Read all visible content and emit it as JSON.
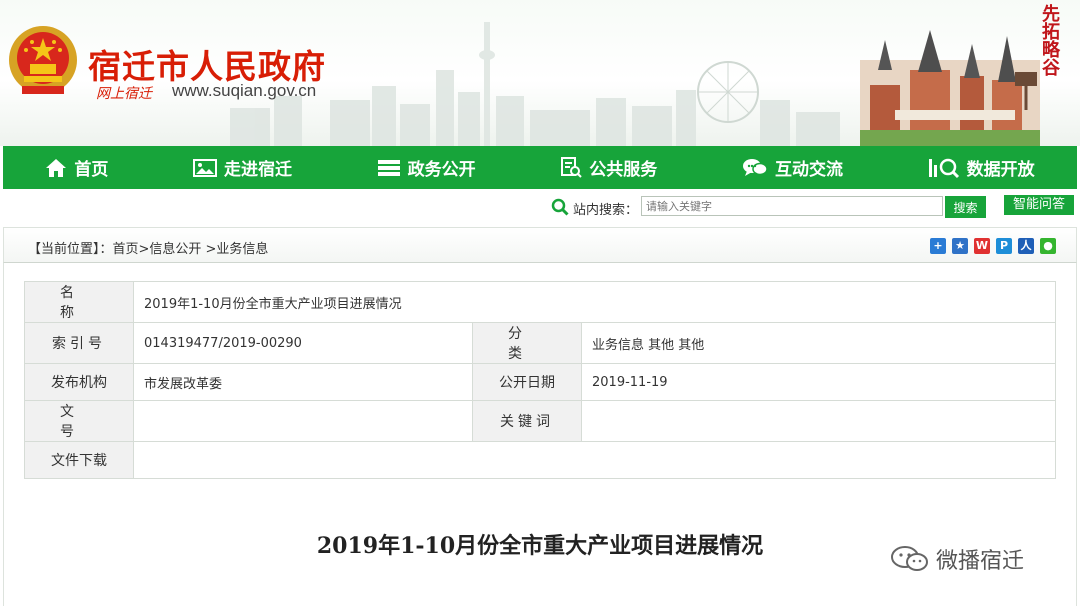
{
  "header": {
    "site_name": "宿迁市人民政府",
    "slogan": "网上宿迁",
    "url": "www.suqian.gov.cn",
    "calligraphy": "先拓略谷"
  },
  "nav": {
    "items": [
      {
        "label": "首页",
        "icon": "home-icon"
      },
      {
        "label": "走进宿迁",
        "icon": "picture-icon"
      },
      {
        "label": "政务公开",
        "icon": "list-icon"
      },
      {
        "label": "公共服务",
        "icon": "document-search-icon"
      },
      {
        "label": "互动交流",
        "icon": "chat-icon"
      },
      {
        "label": "数据开放",
        "icon": "data-search-icon"
      }
    ],
    "color": "#17a43a"
  },
  "search": {
    "label": "站内搜索：",
    "placeholder": "请输入关键字",
    "button": "搜索",
    "qa_button": "智能问答"
  },
  "breadcrumb": {
    "text": "【当前位置】：首页>信息公开 >业务信息"
  },
  "meta": {
    "name_label": "名  称",
    "name_value": "2019年1-10月份全市重大产业项目进展情况",
    "index_label": "索引号",
    "index_value": "014319477/2019-00290",
    "category_label": "分  类",
    "category_value": "业务信息   其他    其他",
    "publisher_label": "发布机构",
    "publisher_value": "市发展改革委",
    "date_label": "公开日期",
    "date_value": "2019-11-19",
    "docno_label": "文  号",
    "docno_value": "",
    "keyword_label": "关键词",
    "keyword_value": "",
    "download_label": "文件下载",
    "download_value": ""
  },
  "document": {
    "title": "2019年1-10月份全市重大产业项目进展情况"
  },
  "watermark": {
    "text": "微播宿迁"
  }
}
